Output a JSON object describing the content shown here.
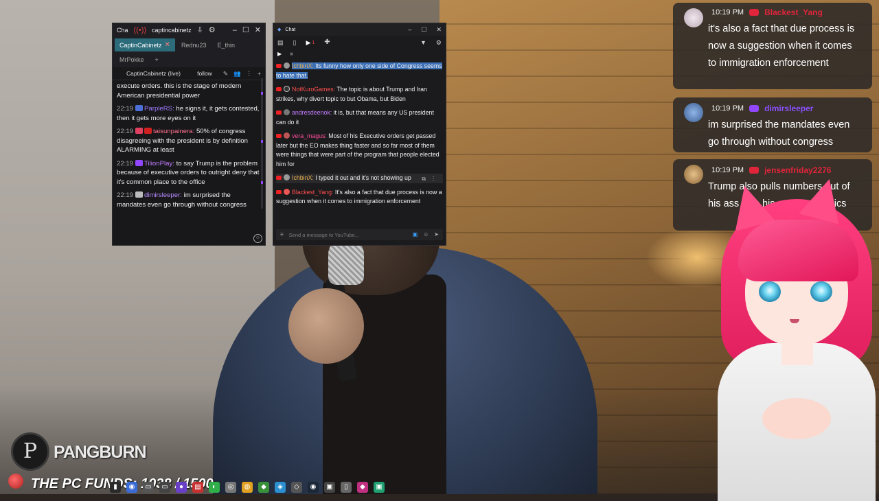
{
  "left_chat": {
    "title": "Cha",
    "channel_tab": "captincabinetz",
    "tabs": [
      {
        "label": "CaptinCabinetz"
      },
      {
        "label": "Rednu23"
      },
      {
        "label": "E_thin"
      },
      {
        "label": "MrPokke"
      }
    ],
    "add_tab": "+",
    "channel_status": "CaptinCabinetz (live)",
    "follow_label": "follow",
    "messages": [
      {
        "time": "",
        "user": "",
        "user_color": "#efeff1",
        "text": "execute orders. this is the stage of modern American presidential power"
      },
      {
        "time": "22:19",
        "user": "ParpleRS:",
        "user_color": "#9e7cff",
        "text": " he signs it, it gets contested, then it gets more eyes on it"
      },
      {
        "time": "22:19",
        "user": "taisunpainera:",
        "user_color": "#ff6f8a",
        "text": " 50% of congress disagreeing with the president is by definition ALARMING at least"
      },
      {
        "time": "22:19",
        "user": "TilionPlay:",
        "user_color": "#c27cff",
        "text": " to say Trump is the problem because of executive orders to outright deny that it's common place to the office"
      },
      {
        "time": "22:19",
        "user": "dimirsleeper:",
        "user_color": "#b98bff",
        "text": " im surprised the mandates even go through without congress"
      }
    ]
  },
  "mid_chat": {
    "title": "Chat",
    "tab_count": "1",
    "messages": [
      {
        "user": "IchbinX:",
        "user_color": "#e9b14b",
        "text": " Its funny how only one side of Congress seems to hate that.",
        "highlight": true
      },
      {
        "user": "NotKuroGames:",
        "user_color": "#ff4d4d",
        "text": " The topic is about Trump and Iran strikes, why divert topic to but Obama, but Biden",
        "highlight": false
      },
      {
        "user": "andresdeenok:",
        "user_color": "#c47cff",
        "text": " it is, but that means any US president can do it",
        "highlight": false
      },
      {
        "user": "vera_magus:",
        "user_color": "#ff4d9a",
        "text": " Most of his Executive orders get passed later but the EO makes thing faster and so far most of them were things that were part of the program that people elected him for",
        "highlight": false
      },
      {
        "user": "IchbinX:",
        "user_color": "#e9b14b",
        "text": " I typed it out and it's not showing up",
        "highlight": false
      },
      {
        "user": "Blackest_Yang:",
        "user_color": "#ff4d4d",
        "text": " It's also a fact that due process is now a suggestion when it comes to immigration enforcement",
        "highlight": false
      }
    ],
    "input_placeholder": "Send a message to YouTube..."
  },
  "overlay": {
    "messages": [
      {
        "time": "10:19 PM",
        "user": "Blackest_Yang",
        "user_color": "#e0243a",
        "platform_color": "#e0243a",
        "avatar_color": "#d9d0d6",
        "text": "it's also a fact that due process is now a suggestion when it comes to immigration enforcement"
      },
      {
        "time": "10:19 PM",
        "user": "dimirsleeper",
        "user_color": "#8a4fff",
        "platform_color": "#9146ff",
        "avatar_color": "#5b7fb8",
        "text": "im surprised the mandates even go through without congress"
      },
      {
        "time": "10:19 PM",
        "user": "jensenfriday2276",
        "user_color": "#e0243a",
        "platform_color": "#e0243a",
        "avatar_color": "#c99a62",
        "text": "Trump also pulls numbers out of his ass with his own economics"
      }
    ]
  },
  "branding": {
    "logo_letter": "P",
    "name": "PANGBURN",
    "funds_text": "THE PC FUNDS: 1038 / 1500"
  },
  "colors": {
    "accent_tab": "#2b6b7a",
    "highlight": "#3b6fb6",
    "youtube": "#e22",
    "twitch": "#9146ff"
  }
}
